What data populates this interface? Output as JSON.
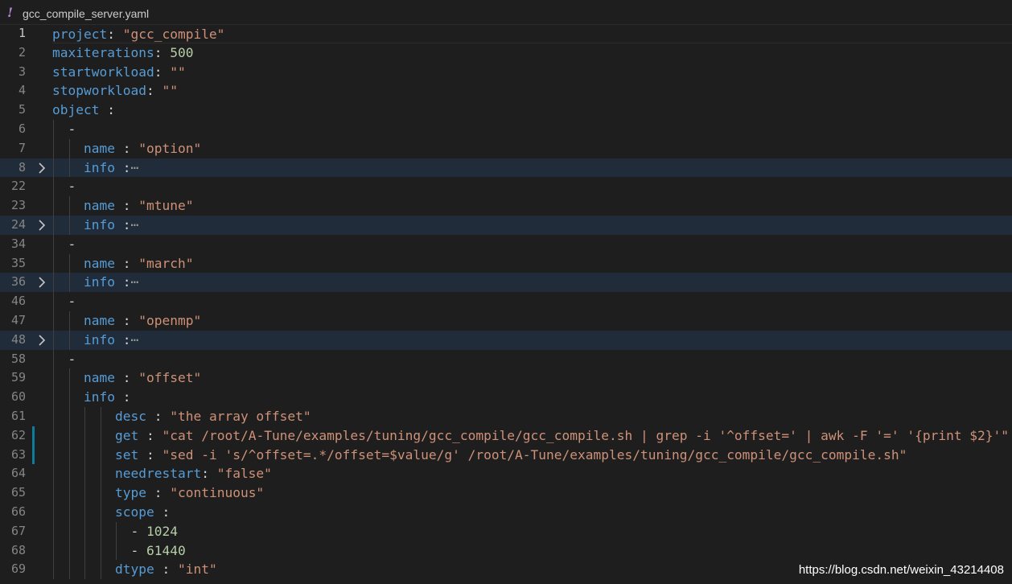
{
  "tab": {
    "icon_glyph": "!",
    "title": "gcc_compile_server.yaml"
  },
  "lines": [
    {
      "num": "1",
      "current": true,
      "indent": 0,
      "tokens": [
        {
          "t": "project",
          "c": "key"
        },
        {
          "t": ": ",
          "c": "pun"
        },
        {
          "t": "\"gcc_compile\"",
          "c": "str"
        }
      ]
    },
    {
      "num": "2",
      "indent": 0,
      "tokens": [
        {
          "t": "maxiterations",
          "c": "key"
        },
        {
          "t": ": ",
          "c": "pun"
        },
        {
          "t": "500",
          "c": "num"
        }
      ]
    },
    {
      "num": "3",
      "indent": 0,
      "tokens": [
        {
          "t": "startworkload",
          "c": "key"
        },
        {
          "t": ": ",
          "c": "pun"
        },
        {
          "t": "\"\"",
          "c": "str"
        }
      ]
    },
    {
      "num": "4",
      "indent": 0,
      "tokens": [
        {
          "t": "stopworkload",
          "c": "key"
        },
        {
          "t": ": ",
          "c": "pun"
        },
        {
          "t": "\"\"",
          "c": "str"
        }
      ]
    },
    {
      "num": "5",
      "indent": 0,
      "tokens": [
        {
          "t": "object",
          "c": "key"
        },
        {
          "t": " :",
          "c": "pun"
        }
      ]
    },
    {
      "num": "6",
      "indent": 1,
      "tokens": [
        {
          "t": "-",
          "c": "pun"
        }
      ]
    },
    {
      "num": "7",
      "indent": 2,
      "tokens": [
        {
          "t": "name",
          "c": "key"
        },
        {
          "t": " : ",
          "c": "pun"
        },
        {
          "t": "\"option\"",
          "c": "str"
        }
      ]
    },
    {
      "num": "8",
      "indent": 2,
      "folded": true,
      "tokens": [
        {
          "t": "info",
          "c": "key"
        },
        {
          "t": " :",
          "c": "pun"
        },
        {
          "t": "⋯",
          "c": "fold-ellipsis"
        }
      ]
    },
    {
      "num": "22",
      "indent": 1,
      "tokens": [
        {
          "t": "-",
          "c": "pun"
        }
      ]
    },
    {
      "num": "23",
      "indent": 2,
      "tokens": [
        {
          "t": "name",
          "c": "key"
        },
        {
          "t": " : ",
          "c": "pun"
        },
        {
          "t": "\"mtune\"",
          "c": "str"
        }
      ]
    },
    {
      "num": "24",
      "indent": 2,
      "folded": true,
      "tokens": [
        {
          "t": "info",
          "c": "key"
        },
        {
          "t": " :",
          "c": "pun"
        },
        {
          "t": "⋯",
          "c": "fold-ellipsis"
        }
      ]
    },
    {
      "num": "34",
      "indent": 1,
      "tokens": [
        {
          "t": "-",
          "c": "pun"
        }
      ]
    },
    {
      "num": "35",
      "indent": 2,
      "tokens": [
        {
          "t": "name",
          "c": "key"
        },
        {
          "t": " : ",
          "c": "pun"
        },
        {
          "t": "\"march\"",
          "c": "str"
        }
      ]
    },
    {
      "num": "36",
      "indent": 2,
      "folded": true,
      "tokens": [
        {
          "t": "info",
          "c": "key"
        },
        {
          "t": " :",
          "c": "pun"
        },
        {
          "t": "⋯",
          "c": "fold-ellipsis"
        }
      ]
    },
    {
      "num": "46",
      "indent": 1,
      "tokens": [
        {
          "t": "-",
          "c": "pun"
        }
      ]
    },
    {
      "num": "47",
      "indent": 2,
      "tokens": [
        {
          "t": "name",
          "c": "key"
        },
        {
          "t": " : ",
          "c": "pun"
        },
        {
          "t": "\"openmp\"",
          "c": "str"
        }
      ]
    },
    {
      "num": "48",
      "indent": 2,
      "folded": true,
      "tokens": [
        {
          "t": "info",
          "c": "key"
        },
        {
          "t": " :",
          "c": "pun"
        },
        {
          "t": "⋯",
          "c": "fold-ellipsis"
        }
      ]
    },
    {
      "num": "58",
      "indent": 1,
      "tokens": [
        {
          "t": "-",
          "c": "pun"
        }
      ]
    },
    {
      "num": "59",
      "indent": 2,
      "tokens": [
        {
          "t": "name",
          "c": "key"
        },
        {
          "t": " : ",
          "c": "pun"
        },
        {
          "t": "\"offset\"",
          "c": "str"
        }
      ]
    },
    {
      "num": "60",
      "indent": 2,
      "tokens": [
        {
          "t": "info",
          "c": "key"
        },
        {
          "t": " :",
          "c": "pun"
        }
      ]
    },
    {
      "num": "61",
      "indent": 4,
      "tokens": [
        {
          "t": "desc",
          "c": "key"
        },
        {
          "t": " : ",
          "c": "pun"
        },
        {
          "t": "\"the array offset\"",
          "c": "str"
        }
      ]
    },
    {
      "num": "62",
      "indent": 4,
      "modified": true,
      "tokens": [
        {
          "t": "get",
          "c": "key"
        },
        {
          "t": " : ",
          "c": "pun"
        },
        {
          "t": "\"cat /root/A-Tune/examples/tuning/gcc_compile/gcc_compile.sh | grep -i '^offset=' | awk -F '=' '{print $2}'\"",
          "c": "str"
        }
      ]
    },
    {
      "num": "63",
      "indent": 4,
      "modified": true,
      "tokens": [
        {
          "t": "set",
          "c": "key"
        },
        {
          "t": " : ",
          "c": "pun"
        },
        {
          "t": "\"sed -i 's/^offset=.*/offset=$value/g' /root/A-Tune/examples/tuning/gcc_compile/gcc_compile.sh\"",
          "c": "str"
        }
      ]
    },
    {
      "num": "64",
      "indent": 4,
      "tokens": [
        {
          "t": "needrestart",
          "c": "key"
        },
        {
          "t": ": ",
          "c": "pun"
        },
        {
          "t": "\"false\"",
          "c": "str"
        }
      ]
    },
    {
      "num": "65",
      "indent": 4,
      "tokens": [
        {
          "t": "type",
          "c": "key"
        },
        {
          "t": " : ",
          "c": "pun"
        },
        {
          "t": "\"continuous\"",
          "c": "str"
        }
      ]
    },
    {
      "num": "66",
      "indent": 4,
      "tokens": [
        {
          "t": "scope",
          "c": "key"
        },
        {
          "t": " :",
          "c": "pun"
        }
      ]
    },
    {
      "num": "67",
      "indent": 5,
      "tokens": [
        {
          "t": "- ",
          "c": "pun"
        },
        {
          "t": "1024",
          "c": "num"
        }
      ]
    },
    {
      "num": "68",
      "indent": 5,
      "tokens": [
        {
          "t": "- ",
          "c": "pun"
        },
        {
          "t": "61440",
          "c": "num"
        }
      ]
    },
    {
      "num": "69",
      "indent": 4,
      "tokens": [
        {
          "t": "dtype",
          "c": "key"
        },
        {
          "t": " : ",
          "c": "pun"
        },
        {
          "t": "\"int\"",
          "c": "str"
        }
      ]
    }
  ],
  "watermark": "https://blog.csdn.net/weixin_43214408",
  "colors": {
    "background": "#1e1e1e",
    "key": "#569cd6",
    "string": "#ce9178",
    "number": "#b5cea8",
    "fold_highlight": "#212c3b",
    "modified_bar": "#0c7d9d"
  }
}
